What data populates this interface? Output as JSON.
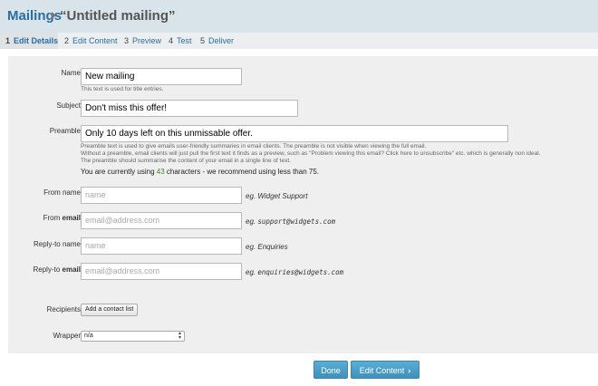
{
  "breadcrumb": {
    "root": "Mailings",
    "current": "“Untitled mailing”"
  },
  "steps": [
    {
      "num": "1",
      "label": "Edit Details"
    },
    {
      "num": "2",
      "label": "Edit Content"
    },
    {
      "num": "3",
      "label": "Preview"
    },
    {
      "num": "4",
      "label": "Test"
    },
    {
      "num": "5",
      "label": "Deliver"
    }
  ],
  "form": {
    "name": {
      "label": "Name",
      "value": "New mailing",
      "help": "This text is used for title entries."
    },
    "subject": {
      "label": "Subject",
      "value": "Don't miss this offer!"
    },
    "preamble": {
      "label": "Preamble",
      "value": "Only 10 days left on this unmissable offer.",
      "help1": "Preamble text is used to give emails user-friendly summaries in email clients. The preamble is not visible when viewing the full email.",
      "help2": "Without a preamble, email clients will just pull the first text it finds as a preview, such as \"Problem viewing this email? Click here to unsubscribe\" etc. which is generally non ideal.",
      "help3": "The preamble should summarise the content of your email in a single line of text.",
      "count_prefix": "You are currently using",
      "count_value": "43",
      "count_suffix": "characters - we recommend using less than 75."
    },
    "from_name": {
      "label": "From name",
      "placeholder": "name",
      "eg_prefix": "eg.",
      "eg": "Widget Support"
    },
    "from_email": {
      "label_prefix": "From",
      "label_bold": "email",
      "placeholder": "email@address.com",
      "eg_prefix": "eg.",
      "eg": "support@widgets.com"
    },
    "reply_name": {
      "label": "Reply-to name",
      "placeholder": "name",
      "eg_prefix": "eg.",
      "eg": "Enquiries"
    },
    "reply_email": {
      "label_prefix": "Reply-to",
      "label_bold": "email",
      "placeholder": "email@address.com",
      "eg_prefix": "eg.",
      "eg": "enquiries@widgets.com"
    },
    "recipients": {
      "label": "Recipients",
      "button": "Add a contact list"
    },
    "wrapper": {
      "label": "Wrapper",
      "selected": "n/a"
    }
  },
  "actions": {
    "done": "Done",
    "next": "Edit Content",
    "next_icon": "chevron-right-icon"
  },
  "colors": {
    "header_bg": "#d9e4ea",
    "link": "#2a6da2",
    "button_blue": "#4a9cc8",
    "count_green": "#3c8a1e"
  }
}
